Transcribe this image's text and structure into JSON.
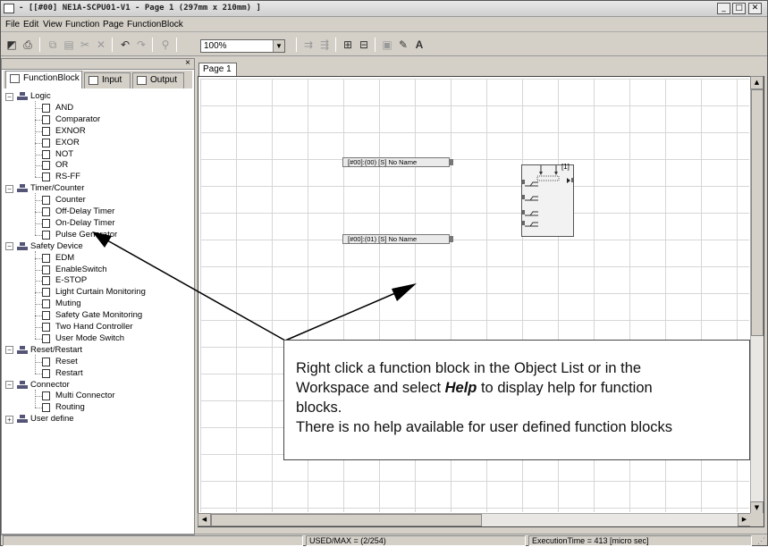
{
  "title": "- [[#00] NE1A-SCPU01-V1 - Page 1 (297mm x 210mm) ]",
  "window_buttons": {
    "minimize": "_",
    "maximize": "□",
    "close": "✕"
  },
  "menu": [
    "File",
    "Edit",
    "View",
    "Function",
    "Page",
    "FunctionBlock"
  ],
  "toolbar": {
    "zoom": "100%",
    "icons": [
      "new-icon",
      "print-icon",
      "copy-icon",
      "paste-icon",
      "cut-icon",
      "delete-icon",
      "undo-icon",
      "redo-icon",
      "find-icon",
      "align-icon",
      "distribute-icon",
      "page-add-icon",
      "page-remove-icon",
      "properties-icon",
      "edit-icon",
      "text-icon"
    ],
    "text_button": "A"
  },
  "panel": {
    "close": "×",
    "tabs": [
      "FunctionBlock",
      "Input",
      "Output"
    ]
  },
  "tree": [
    {
      "label": "Logic",
      "children": [
        "AND",
        "Comparator",
        "EXNOR",
        "EXOR",
        "NOT",
        "OR",
        "RS-FF"
      ]
    },
    {
      "label": "Timer/Counter",
      "children": [
        "Counter",
        "Off-Delay Timer",
        "On-Delay Timer",
        "Pulse Generator"
      ]
    },
    {
      "label": "Safety Device",
      "children": [
        "EDM",
        "EnableSwitch",
        "E-STOP",
        "Light Curtain Monitoring",
        "Muting",
        "Safety Gate Monitoring",
        "Two Hand Controller",
        "User Mode Switch"
      ]
    },
    {
      "label": "Reset/Restart",
      "children": [
        "Reset",
        "Restart"
      ]
    },
    {
      "label": "Connector",
      "children": [
        "Multi Connector",
        "Routing"
      ]
    },
    {
      "label": "User define",
      "children": [],
      "collapsed": true
    }
  ],
  "workspace": {
    "page_tab": "Page 1",
    "inputs": [
      "[#00]:(00) [S] No Name",
      "[#00]:(01) [S] No Name"
    ],
    "block_label": "[1]"
  },
  "callout": {
    "line1": "Right click a function block in the Object List or in the",
    "line2_pre": "Workspace and select ",
    "line2_em": "Help",
    "line2_post": " to display help for function",
    "line3": "blocks.",
    "line4": "There is no help available for user defined function blocks"
  },
  "status": {
    "used": "USED/MAX = (2/254)",
    "exec": "ExecutionTime = 413 [micro sec]"
  }
}
